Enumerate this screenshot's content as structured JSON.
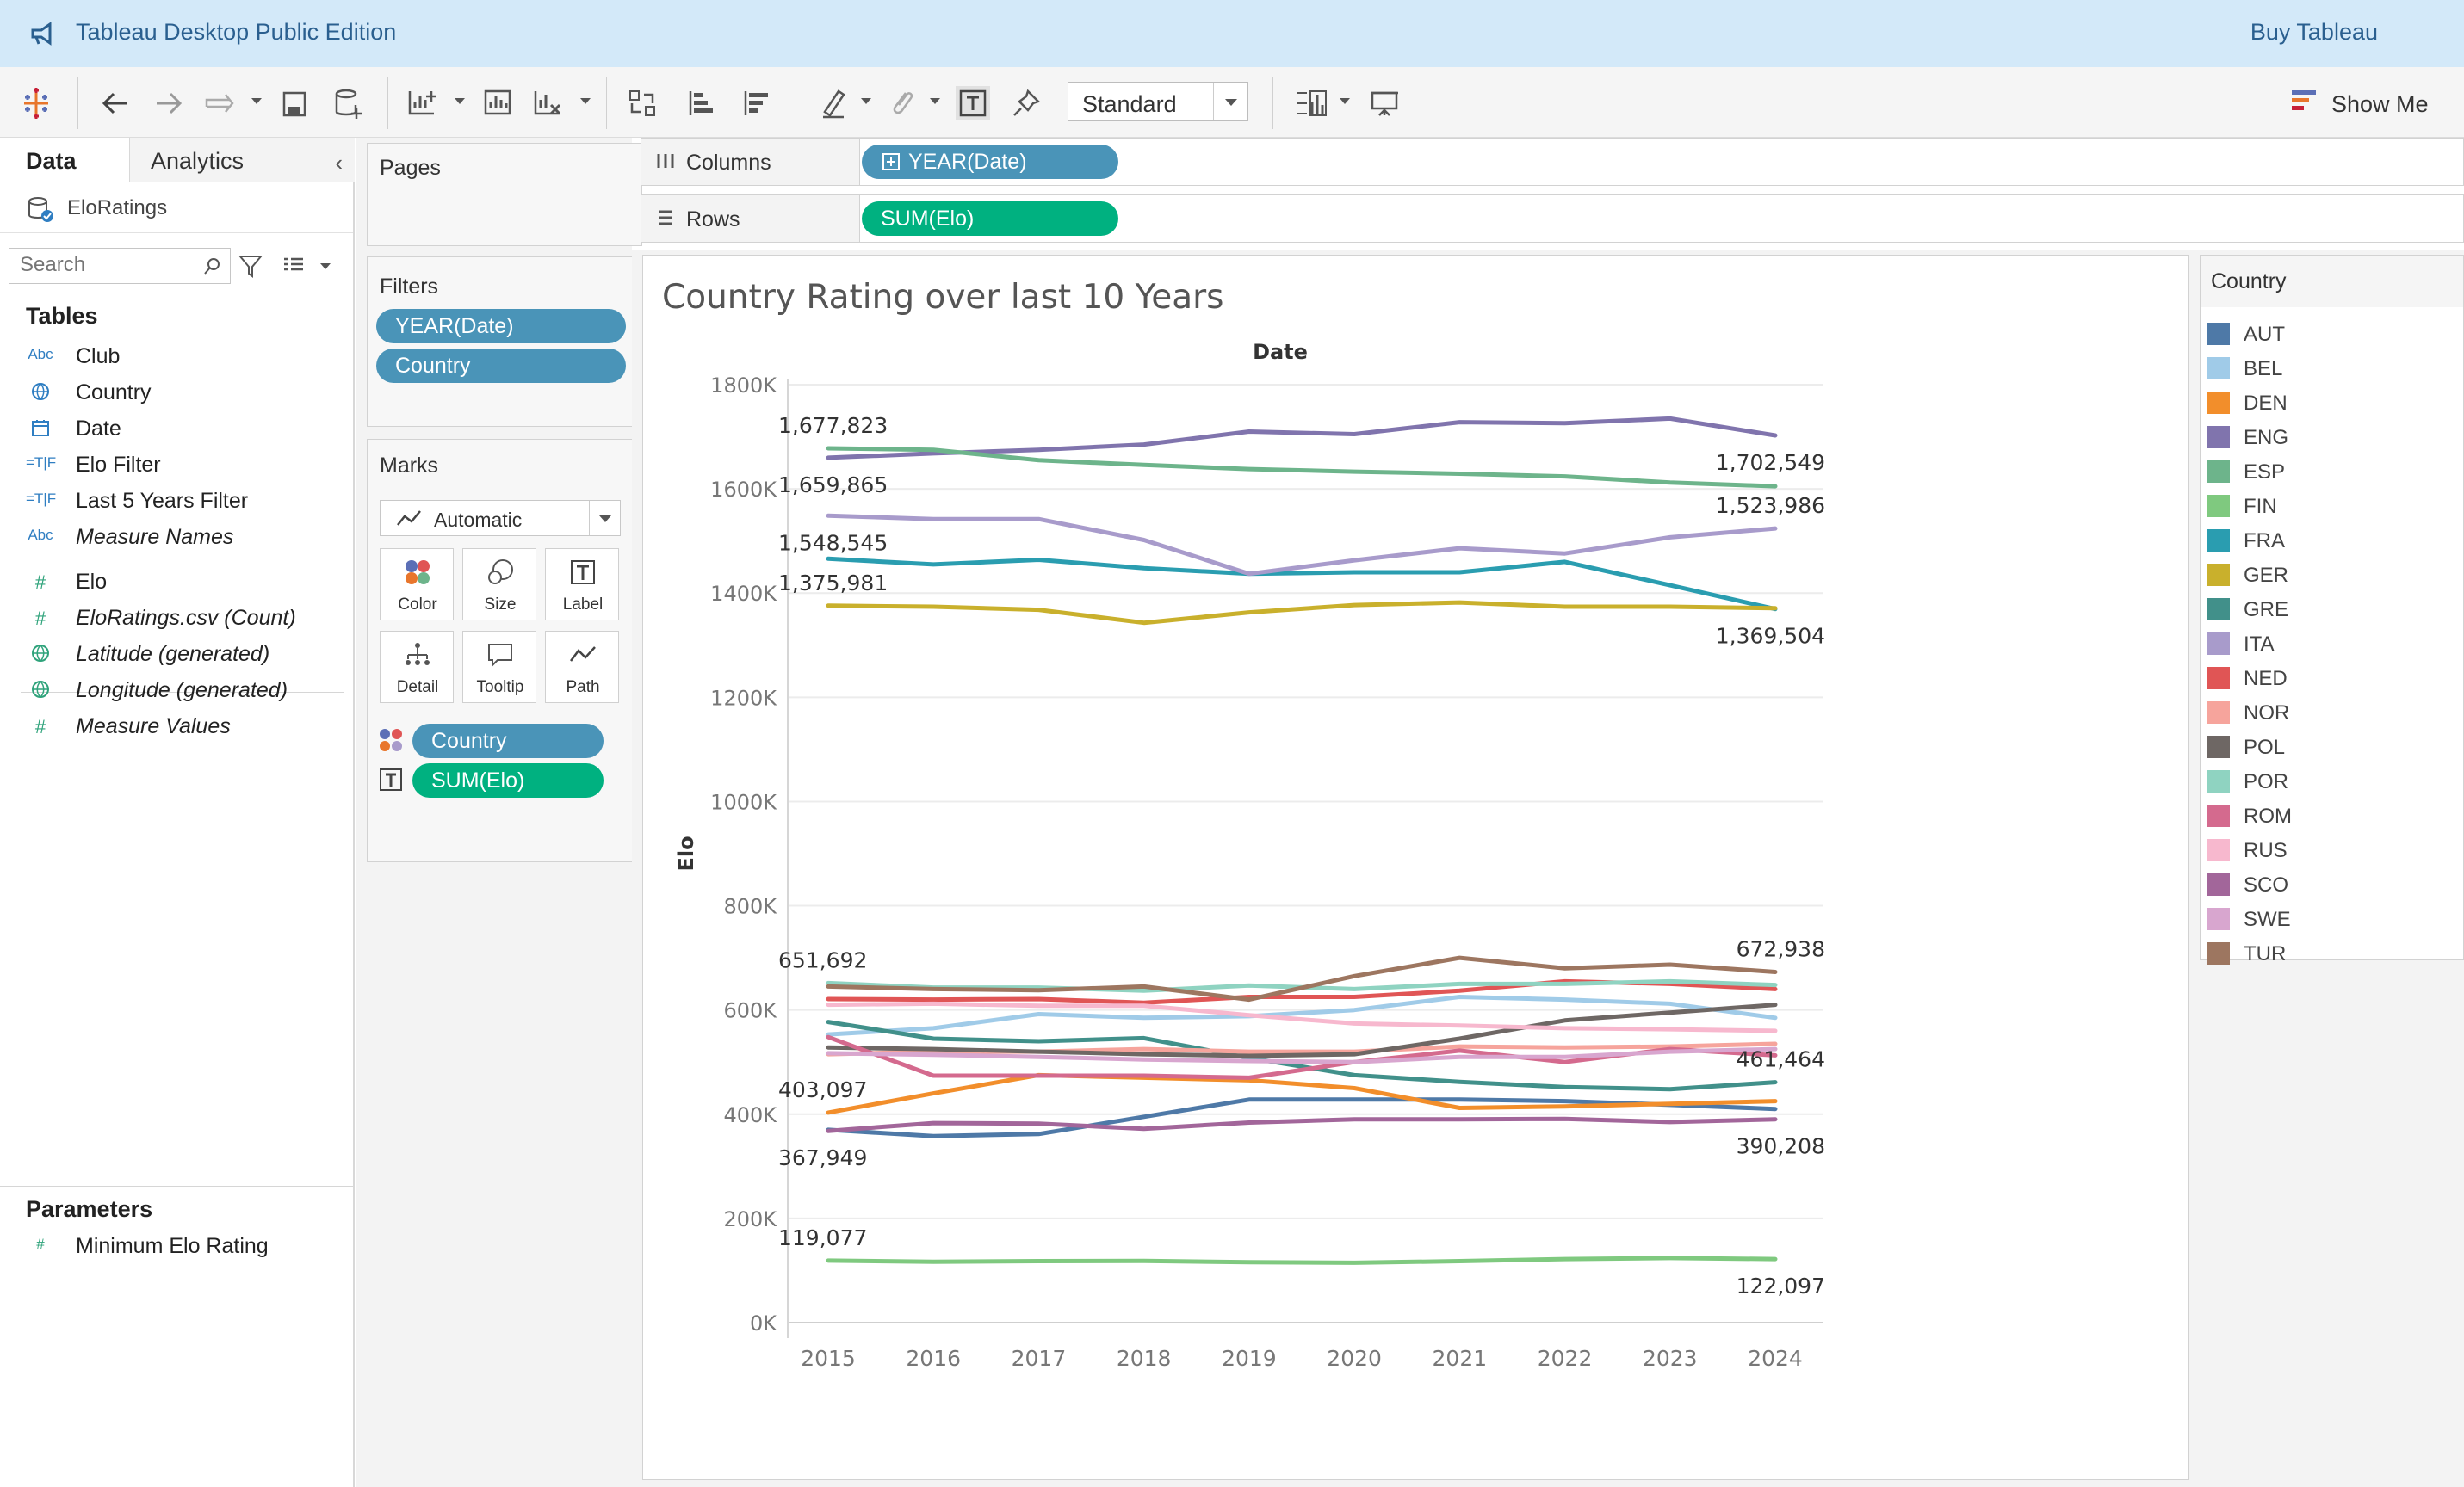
{
  "app": {
    "title": "Tableau Desktop Public Edition",
    "buy_link": "Buy Tableau"
  },
  "toolbar": {
    "fit_value": "Standard",
    "show_me": "Show Me"
  },
  "data_pane": {
    "tabs": [
      "Data",
      "Analytics"
    ],
    "datasource": "EloRatings",
    "search_placeholder": "Search",
    "tables_heading": "Tables",
    "fields": [
      {
        "name": "Club",
        "type": "Abc",
        "kind": "dim",
        "italic": false
      },
      {
        "name": "Country",
        "type": "globe",
        "kind": "dim",
        "italic": false
      },
      {
        "name": "Date",
        "type": "calendar",
        "kind": "dim",
        "italic": false
      },
      {
        "name": "Elo Filter",
        "type": "=T|F",
        "kind": "dim",
        "italic": false
      },
      {
        "name": "Last 5 Years Filter",
        "type": "=T|F",
        "kind": "dim",
        "italic": false
      },
      {
        "name": "Measure Names",
        "type": "Abc",
        "kind": "dim",
        "italic": true
      },
      {
        "name": "Elo",
        "type": "#",
        "kind": "meas",
        "italic": false
      },
      {
        "name": "EloRatings.csv (Count)",
        "type": "#",
        "kind": "meas",
        "italic": true
      },
      {
        "name": "Latitude (generated)",
        "type": "globe",
        "kind": "meas",
        "italic": true
      },
      {
        "name": "Longitude (generated)",
        "type": "globe",
        "kind": "meas",
        "italic": true
      },
      {
        "name": "Measure Values",
        "type": "#",
        "kind": "meas",
        "italic": true
      }
    ],
    "parameters_heading": "Parameters",
    "parameters": [
      {
        "name": "Minimum Elo Rating",
        "type": "#"
      }
    ]
  },
  "cards": {
    "pages": "Pages",
    "filters": "Filters",
    "filter_pills": [
      "YEAR(Date)",
      "Country"
    ],
    "marks": "Marks",
    "mark_type": "Automatic",
    "mark_buttons": [
      "Color",
      "Size",
      "Label",
      "Detail",
      "Tooltip",
      "Path"
    ],
    "mark_pills": [
      {
        "label": "Country",
        "kind": "dim",
        "icon": "color-dots-icon"
      },
      {
        "label": "SUM(Elo)",
        "kind": "meas",
        "icon": "label-t-icon"
      }
    ]
  },
  "shelves": {
    "columns_label": "Columns",
    "columns_pill": "YEAR(Date)",
    "rows_label": "Rows",
    "rows_pill": "SUM(Elo)"
  },
  "chart_data": {
    "type": "line",
    "title": "Country Rating over last 10 Years",
    "xlabel": "Date",
    "ylabel": "Elo",
    "x": [
      2015,
      2016,
      2017,
      2018,
      2019,
      2020,
      2021,
      2022,
      2023,
      2024
    ],
    "y_ticks": [
      "0K",
      "200K",
      "400K",
      "600K",
      "800K",
      "1000K",
      "1200K",
      "1400K",
      "1600K",
      "1800K"
    ],
    "ylim": [
      0,
      1800000
    ],
    "grid": "horizontal",
    "legend_title": "Country",
    "legend_position": "right",
    "series": [
      {
        "name": "AUT",
        "color": "#4e79a7",
        "values": [
          370000,
          358000,
          362000,
          395000,
          428000,
          428000,
          428000,
          425000,
          418000,
          410000
        ]
      },
      {
        "name": "BEL",
        "color": "#a0cbe8",
        "values": [
          553000,
          565000,
          592000,
          585000,
          588000,
          600000,
          625000,
          620000,
          612000,
          585000
        ]
      },
      {
        "name": "DEN",
        "color": "#f28e2b",
        "values": [
          403097,
          440000,
          475000,
          470000,
          465000,
          450000,
          412000,
          415000,
          420000,
          425000
        ]
      },
      {
        "name": "ENG",
        "color": "#8074ad",
        "values": [
          1659865,
          1668000,
          1675000,
          1685000,
          1710000,
          1705000,
          1728000,
          1726000,
          1735000,
          1702549
        ]
      },
      {
        "name": "ESP",
        "color": "#6db48b",
        "values": [
          1677823,
          1675000,
          1655000,
          1646000,
          1638000,
          1633000,
          1629000,
          1624000,
          1612000,
          1605000
        ]
      },
      {
        "name": "FIN",
        "color": "#7fc97f",
        "values": [
          119077,
          117000,
          118000,
          118500,
          116000,
          115000,
          118000,
          122000,
          124000,
          122097
        ]
      },
      {
        "name": "FRA",
        "color": "#2a9db0",
        "values": [
          1466000,
          1455000,
          1464000,
          1448000,
          1437000,
          1440000,
          1440000,
          1460000,
          1415000,
          1369504
        ]
      },
      {
        "name": "GER",
        "color": "#c9b02c",
        "values": [
          1375981,
          1374000,
          1368000,
          1343000,
          1363000,
          1377000,
          1382000,
          1374000,
          1374000,
          1371000
        ]
      },
      {
        "name": "GRE",
        "color": "#41908a",
        "values": [
          577000,
          545000,
          540000,
          546000,
          508000,
          475000,
          462000,
          452000,
          448000,
          461464
        ]
      },
      {
        "name": "ITA",
        "color": "#a89bcb",
        "values": [
          1548545,
          1542000,
          1542000,
          1502000,
          1437000,
          1463000,
          1486000,
          1476000,
          1507000,
          1523986
        ]
      },
      {
        "name": "NED",
        "color": "#e05555",
        "values": [
          621000,
          620000,
          621000,
          614000,
          625000,
          625000,
          637000,
          655000,
          650000,
          640000
        ]
      },
      {
        "name": "NOR",
        "color": "#f6a49c",
        "values": [
          515000,
          520000,
          520000,
          525000,
          520000,
          520000,
          530000,
          528000,
          530000,
          535000
        ]
      },
      {
        "name": "POL",
        "color": "#6e6764",
        "values": [
          528000,
          525000,
          520000,
          515000,
          512000,
          515000,
          545000,
          580000,
          595000,
          610000
        ]
      },
      {
        "name": "POR",
        "color": "#8fd3c1",
        "values": [
          651692,
          643000,
          643000,
          637000,
          647000,
          640000,
          650000,
          650000,
          655000,
          648000
        ]
      },
      {
        "name": "ROM",
        "color": "#d46a8e",
        "values": [
          548000,
          474000,
          474000,
          474000,
          470000,
          500000,
          522000,
          500000,
          525000,
          513000
        ]
      },
      {
        "name": "RUS",
        "color": "#f7b8ce",
        "values": [
          610000,
          612000,
          608000,
          608000,
          590000,
          574000,
          570000,
          565000,
          563000,
          560000
        ]
      },
      {
        "name": "SCO",
        "color": "#a2669a",
        "values": [
          367949,
          383000,
          382000,
          372000,
          384000,
          390000,
          390000,
          391000,
          385000,
          390208
        ]
      },
      {
        "name": "SWE",
        "color": "#d8a6cf",
        "values": [
          517000,
          514000,
          510000,
          505000,
          502000,
          500000,
          510000,
          510000,
          520000,
          525000
        ]
      },
      {
        "name": "TUR",
        "color": "#9d7660",
        "values": [
          645000,
          640000,
          638000,
          645000,
          620000,
          665000,
          700000,
          680000,
          687000,
          672938
        ]
      }
    ],
    "data_labels": [
      {
        "series": "ESP",
        "year": 2015,
        "text": "1,677,823",
        "pos": "above"
      },
      {
        "series": "ENG",
        "year": 2015,
        "text": "1,659,865",
        "pos": "below"
      },
      {
        "series": "ENG",
        "year": 2024,
        "text": "1,702,549",
        "pos": "below"
      },
      {
        "series": "ITA",
        "year": 2015,
        "text": "1,548,545",
        "pos": "below"
      },
      {
        "series": "ITA",
        "year": 2024,
        "text": "1,523,986",
        "pos": "above"
      },
      {
        "series": "GER",
        "year": 2015,
        "text": "1,375,981",
        "pos": "above"
      },
      {
        "series": "FRA",
        "year": 2024,
        "text": "1,369,504",
        "pos": "below"
      },
      {
        "series": "POR",
        "year": 2015,
        "text": "651,692",
        "pos": "above"
      },
      {
        "series": "TUR",
        "year": 2024,
        "text": "672,938",
        "pos": "above"
      },
      {
        "series": "DEN",
        "year": 2015,
        "text": "403,097",
        "pos": "above"
      },
      {
        "series": "GRE",
        "year": 2024,
        "text": "461,464",
        "pos": "above"
      },
      {
        "series": "SCO",
        "year": 2015,
        "text": "367,949",
        "pos": "below"
      },
      {
        "series": "SCO",
        "year": 2024,
        "text": "390,208",
        "pos": "below"
      },
      {
        "series": "FIN",
        "year": 2015,
        "text": "119,077",
        "pos": "above"
      },
      {
        "series": "FIN",
        "year": 2024,
        "text": "122,097",
        "pos": "below"
      }
    ]
  }
}
